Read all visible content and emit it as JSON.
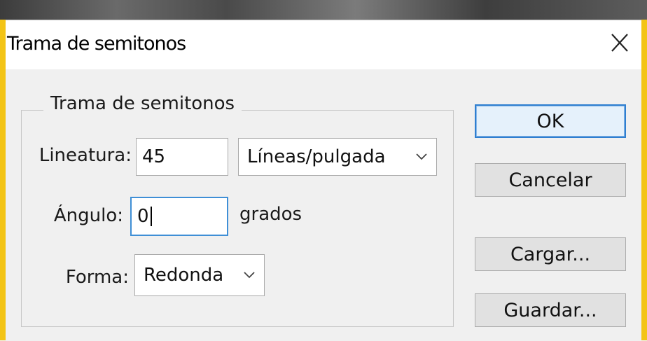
{
  "dialog": {
    "title": "Trama de semitonos",
    "close_glyph": "X"
  },
  "group": {
    "legend": "Trama de semitonos",
    "lineatura": {
      "label": "Lineatura:",
      "value": "45",
      "unit": "Líneas/pulgada"
    },
    "angulo": {
      "label": "Ángulo:",
      "value": "0",
      "unit": "grados"
    },
    "forma": {
      "label": "Forma:",
      "value": "Redonda"
    }
  },
  "buttons": {
    "ok": "OK",
    "cancel": "Cancelar",
    "load": "Cargar...",
    "save": "Guardar..."
  },
  "colors": {
    "accent_frame": "#f3c416",
    "default_button_border": "#2f7fd0",
    "focus_border": "#3f8fd6"
  },
  "icons": {
    "close": "close-icon",
    "dropdown": "chevron-down-icon"
  }
}
